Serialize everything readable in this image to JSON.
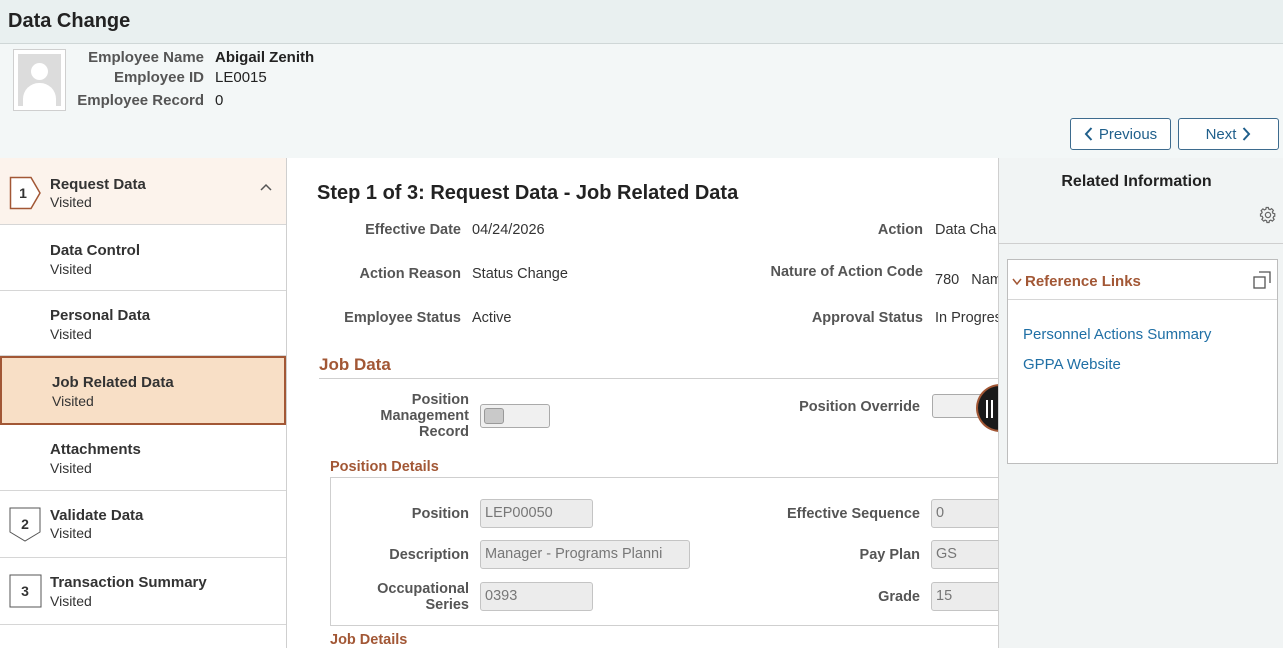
{
  "page": {
    "title": "Data Change"
  },
  "employee": {
    "name_label": "Employee Name",
    "name": "Abigail Zenith",
    "id_label": "Employee ID",
    "id": "LE0015",
    "record_label": "Employee Record",
    "record": "0"
  },
  "nav_buttons": {
    "previous": "Previous",
    "next": "Next"
  },
  "left_nav": {
    "step1": {
      "number": "1",
      "label": "Request Data",
      "status": "Visited"
    },
    "items": [
      {
        "label": "Data Control",
        "status": "Visited"
      },
      {
        "label": "Personal Data",
        "status": "Visited"
      },
      {
        "label": "Job Related Data",
        "status": "Visited"
      },
      {
        "label": "Attachments",
        "status": "Visited"
      }
    ],
    "step2": {
      "number": "2",
      "label": "Validate Data",
      "status": "Visited"
    },
    "step3": {
      "number": "3",
      "label": "Transaction Summary",
      "status": "Visited"
    }
  },
  "main": {
    "title": "Step 1 of 3: Request Data - Job Related Data",
    "effective_date_label": "Effective Date",
    "effective_date": "04/24/2026",
    "action_label": "Action",
    "action": "Data Cha",
    "action_reason_label": "Action Reason",
    "action_reason": "Status Change",
    "nature_label": "Nature of Action Code",
    "nature_code": "780",
    "nature_text": "Nam",
    "employee_status_label": "Employee Status",
    "employee_status": "Active",
    "approval_status_label": "Approval Status",
    "approval_status": "In Progres",
    "job_data_heading": "Job Data",
    "pmr_label": "Position Management Record",
    "position_override_label": "Position Override",
    "position_details_heading": "Position Details",
    "position_label": "Position",
    "position": "LEP00050",
    "eff_seq_label": "Effective Sequence",
    "eff_seq": "0",
    "description_label": "Description",
    "description": "Manager - Programs Planni",
    "pay_plan_label": "Pay Plan",
    "pay_plan": "GS",
    "occ_series_label": "Occupational Series",
    "occ_series": "0393",
    "grade_label": "Grade",
    "grade": "15",
    "job_details_heading": "Job Details"
  },
  "related_info": {
    "title": "Related Information",
    "reference_links_title": "Reference Links",
    "links": [
      "Personnel Actions Summary",
      "GPPA Website"
    ]
  },
  "colors": {
    "accent": "#a25735",
    "link": "#1f6fa5",
    "active_bg": "#f8dfc6"
  },
  "icons": [
    "gear-icon",
    "chevron-left-icon",
    "chevron-right-icon",
    "chevron-up-icon",
    "chevron-down-icon",
    "expand-icon",
    "drag-handle-icon",
    "avatar-icon"
  ]
}
